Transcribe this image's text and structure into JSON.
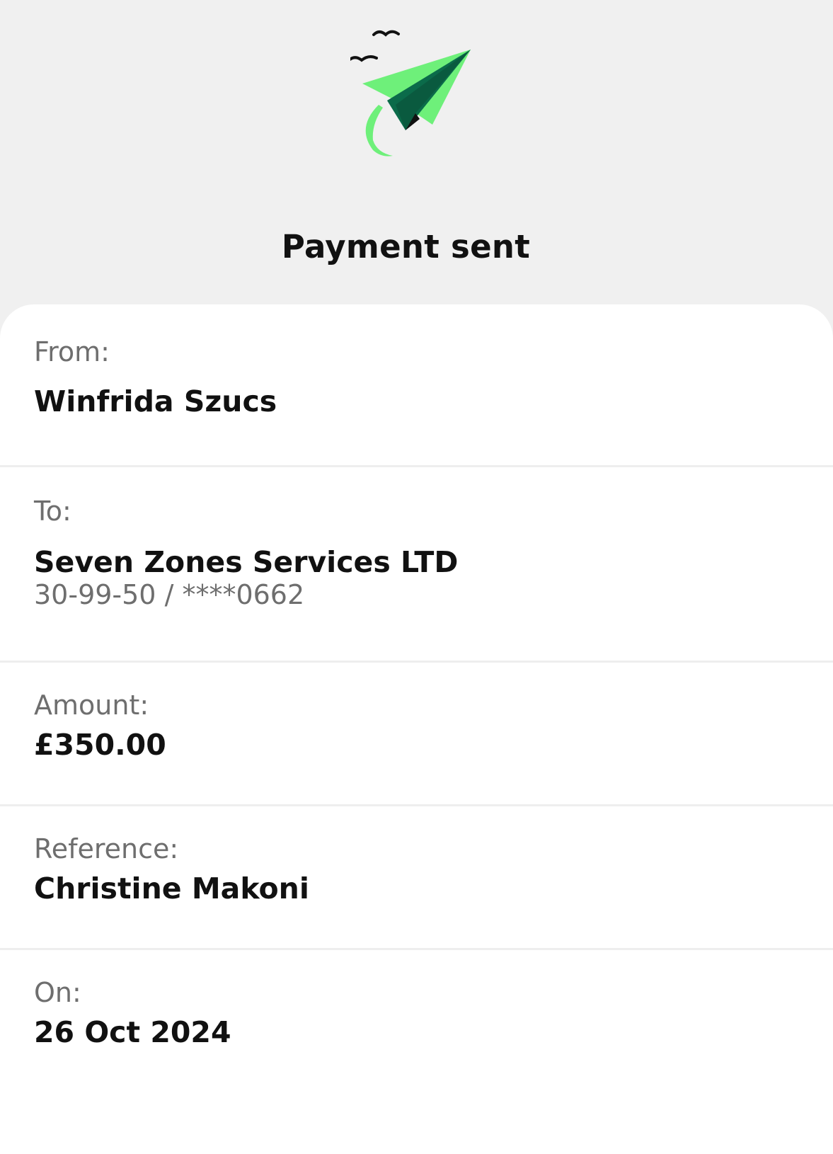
{
  "header": {
    "title": "Payment sent",
    "icon": "paper-plane-icon",
    "accent_color": "#6ef07a",
    "dark_green": "#0b6b4a"
  },
  "details": {
    "from": {
      "label": "From:",
      "value": "Winfrida Szucs"
    },
    "to": {
      "label": "To:",
      "value": "Seven Zones Services LTD",
      "account": "30-99-50 / ****0662"
    },
    "amount": {
      "label": "Amount:",
      "value": "£350.00"
    },
    "reference": {
      "label": "Reference:",
      "value": "Christine Makoni"
    },
    "date": {
      "label": "On:",
      "value": "26 Oct 2024"
    }
  }
}
